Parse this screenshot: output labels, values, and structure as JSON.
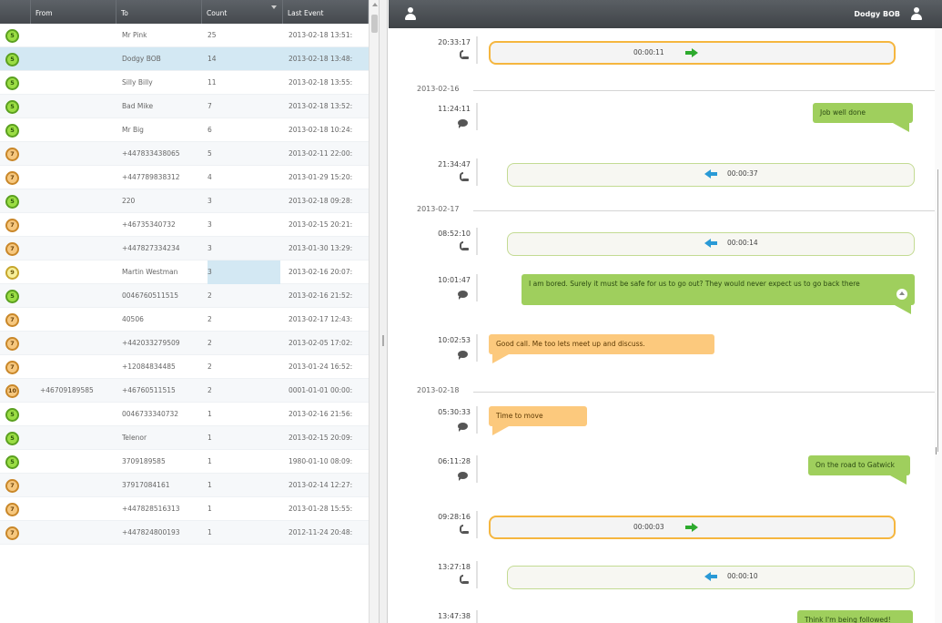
{
  "grid": {
    "columns": {
      "from": "From",
      "to": "To",
      "count": "Count",
      "last_event": "Last Event"
    },
    "rows": [
      {
        "badge": "5",
        "from": "",
        "to": "Mr Pink",
        "count": "25",
        "last": "2013-02-18 13:51:"
      },
      {
        "badge": "5",
        "from": "",
        "to": "Dodgy BOB",
        "count": "14",
        "last": "2013-02-18 13:48:"
      },
      {
        "badge": "5",
        "from": "",
        "to": "Silly Billy",
        "count": "11",
        "last": "2013-02-18 13:55:"
      },
      {
        "badge": "5",
        "from": "",
        "to": "Bad Mike",
        "count": "7",
        "last": "2013-02-18 13:52:"
      },
      {
        "badge": "5",
        "from": "",
        "to": "Mr Big",
        "count": "6",
        "last": "2013-02-18 10:24:"
      },
      {
        "badge": "7",
        "from": "",
        "to": "+447833438065",
        "count": "5",
        "last": "2013-02-11 22:00:"
      },
      {
        "badge": "7",
        "from": "",
        "to": "+447789838312",
        "count": "4",
        "last": "2013-01-29 15:20:"
      },
      {
        "badge": "5",
        "from": "",
        "to": "220",
        "count": "3",
        "last": "2013-02-18 09:28:"
      },
      {
        "badge": "7",
        "from": "",
        "to": "+46735340732",
        "count": "3",
        "last": "2013-02-15 20:21:"
      },
      {
        "badge": "7",
        "from": "",
        "to": "+447827334234",
        "count": "3",
        "last": "2013-01-30 13:29:"
      },
      {
        "badge": "9",
        "from": "",
        "to": "Martin Westman",
        "count": "3",
        "last": "2013-02-16 20:07:"
      },
      {
        "badge": "5",
        "from": "",
        "to": "0046760511515",
        "count": "2",
        "last": "2013-02-16 21:52:"
      },
      {
        "badge": "7",
        "from": "",
        "to": "40506",
        "count": "2",
        "last": "2013-02-17 12:43:"
      },
      {
        "badge": "7",
        "from": "",
        "to": "+442033279509",
        "count": "2",
        "last": "2013-02-05 17:02:"
      },
      {
        "badge": "7",
        "from": "",
        "to": "+12084834485",
        "count": "2",
        "last": "2013-01-24 16:52:"
      },
      {
        "badge": "10",
        "from": "+46709189585",
        "to": "+46760511515",
        "count": "2",
        "last": "0001-01-01 00:00:"
      },
      {
        "badge": "5",
        "from": "",
        "to": "0046733340732",
        "count": "1",
        "last": "2013-02-16 21:56:"
      },
      {
        "badge": "5",
        "from": "",
        "to": "Telenor",
        "count": "1",
        "last": "2013-02-15 20:09:"
      },
      {
        "badge": "5",
        "from": "",
        "to": "3709189585",
        "count": "1",
        "last": "1980-01-10 08:09:"
      },
      {
        "badge": "7",
        "from": "",
        "to": "37917084161",
        "count": "1",
        "last": "2013-02-14 12:27:"
      },
      {
        "badge": "7",
        "from": "",
        "to": "+447828516313",
        "count": "1",
        "last": "2013-01-28 15:55:"
      },
      {
        "badge": "7",
        "from": "",
        "to": "+447824800193",
        "count": "1",
        "last": "2012-11-24 20:48:"
      }
    ]
  },
  "chat": {
    "contact": "Dodgy BOB",
    "items": [
      {
        "type": "call-out",
        "time": "20:33:17",
        "text": "00:00:11"
      },
      {
        "type": "date",
        "text": "2013-02-16"
      },
      {
        "type": "msg-sent",
        "time": "11:24:11",
        "text": "Job well done"
      },
      {
        "type": "call-in",
        "time": "21:34:47",
        "text": "00:00:37"
      },
      {
        "type": "date",
        "text": "2013-02-17"
      },
      {
        "type": "call-in",
        "time": "08:52:10",
        "text": "00:00:14"
      },
      {
        "type": "msg-sent",
        "time": "10:01:47",
        "text": "I am bored. Surely it must be safe for us to go out? They would never expect us to go back there"
      },
      {
        "type": "msg-recv",
        "time": "10:02:53",
        "text": "Good call. Me too lets meet up and discuss."
      },
      {
        "type": "date",
        "text": "2013-02-18"
      },
      {
        "type": "msg-recv",
        "time": "05:30:33",
        "text": "Time to move"
      },
      {
        "type": "msg-sent",
        "time": "06:11:28",
        "text": "On the road to Gatwick"
      },
      {
        "type": "call-out",
        "time": "09:28:16",
        "text": "00:00:03"
      },
      {
        "type": "call-in",
        "time": "13:27:18",
        "text": "00:00:10"
      },
      {
        "type": "msg-sent",
        "time": "13:47:38",
        "text": "Think I'm being followed!"
      }
    ]
  }
}
